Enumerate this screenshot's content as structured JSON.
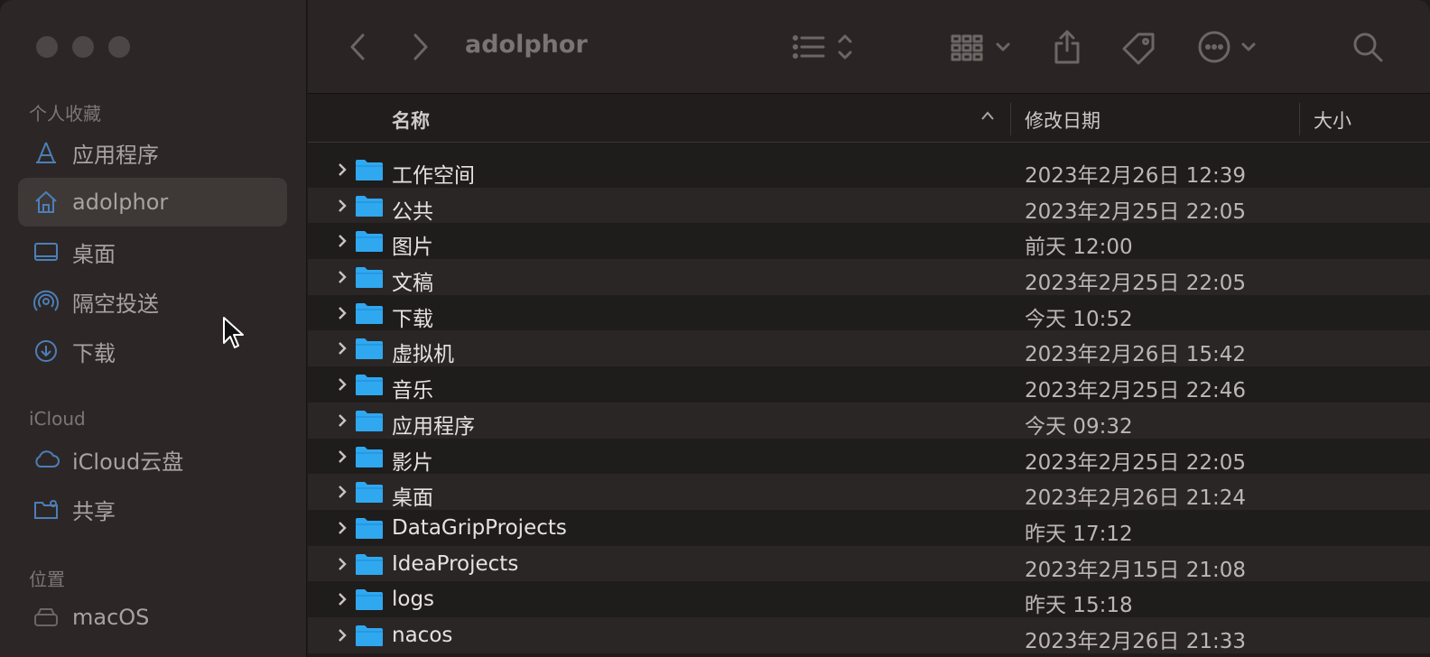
{
  "window": {
    "title": "adolphor"
  },
  "sidebar": {
    "favorites_title": "个人收藏",
    "favorites": [
      {
        "label": "应用程序",
        "icon": "applications-icon"
      },
      {
        "label": "adolphor",
        "icon": "home-icon"
      },
      {
        "label": "桌面",
        "icon": "desktop-icon"
      },
      {
        "label": "隔空投送",
        "icon": "airdrop-icon"
      },
      {
        "label": "下载",
        "icon": "downloads-icon"
      }
    ],
    "icloud_title": "iCloud",
    "icloud": [
      {
        "label": "iCloud云盘",
        "icon": "cloud-icon"
      },
      {
        "label": "共享",
        "icon": "shared-folder-icon"
      }
    ],
    "locations_title": "位置",
    "locations": [
      {
        "label": "macOS",
        "icon": "disk-icon"
      }
    ]
  },
  "columns": {
    "name": "名称",
    "date": "修改日期",
    "size": "大小"
  },
  "rows": [
    {
      "name": "工作空间",
      "date": "2023年2月26日 12:39"
    },
    {
      "name": "公共",
      "date": "2023年2月25日 22:05"
    },
    {
      "name": "图片",
      "date": "前天 12:00"
    },
    {
      "name": "文稿",
      "date": "2023年2月25日 22:05"
    },
    {
      "name": "下载",
      "date": "今天 10:52"
    },
    {
      "name": "虚拟机",
      "date": "2023年2月26日 15:42"
    },
    {
      "name": "音乐",
      "date": "2023年2月25日 22:46"
    },
    {
      "name": "应用程序",
      "date": "今天 09:32"
    },
    {
      "name": "影片",
      "date": "2023年2月25日 22:05"
    },
    {
      "name": "桌面",
      "date": "2023年2月26日 21:24"
    },
    {
      "name": "DataGripProjects",
      "date": "昨天 17:12"
    },
    {
      "name": "IdeaProjects",
      "date": "2023年2月15日 21:08"
    },
    {
      "name": "logs",
      "date": "昨天 15:18"
    },
    {
      "name": "nacos",
      "date": "2023年2月26日 21:33"
    }
  ],
  "colors": {
    "folder": "#2fa8f0",
    "sidebar_icon": "#4c7fb8",
    "selected": "#3e3837"
  }
}
